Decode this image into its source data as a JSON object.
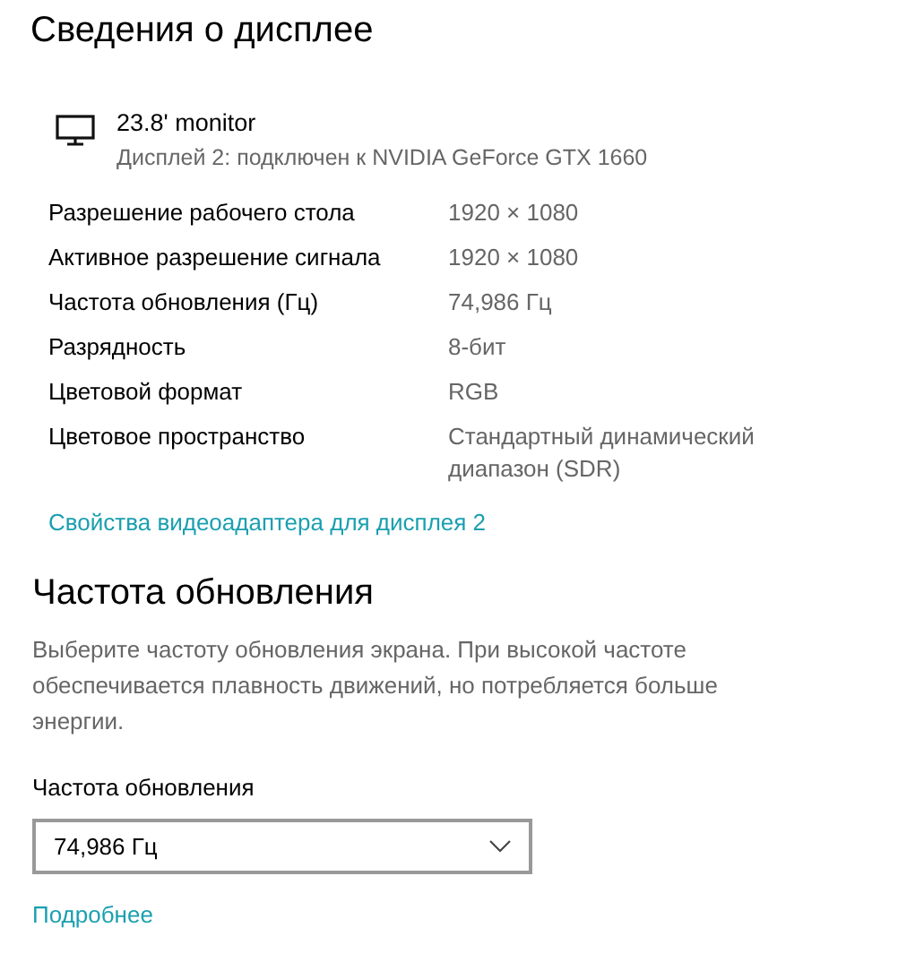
{
  "display_info": {
    "title": "Сведения о дисплее",
    "monitor": {
      "name": "23.8' monitor",
      "connection": "Дисплей 2: подключен к NVIDIA GeForce GTX 1660"
    },
    "properties": [
      {
        "label": "Разрешение рабочего стола",
        "value": "1920 × 1080"
      },
      {
        "label": "Активное разрешение сигнала",
        "value": "1920 × 1080"
      },
      {
        "label": "Частота обновления (Гц)",
        "value": "74,986 Гц"
      },
      {
        "label": "Разрядность",
        "value": "8-бит"
      },
      {
        "label": "Цветовой формат",
        "value": "RGB"
      },
      {
        "label": "Цветовое пространство",
        "value": "Стандартный динамический диапазон (SDR)"
      }
    ],
    "adapter_link": "Свойства видеоадаптера для дисплея 2"
  },
  "refresh_rate": {
    "title": "Частота обновления",
    "description": "Выберите частоту обновления экрана. При высокой частоте обеспечивается плавность движений, но потребляется больше энергии.",
    "field_label": "Частота обновления",
    "dropdown_value": "74,986 Гц",
    "more_link": "Подробнее"
  }
}
